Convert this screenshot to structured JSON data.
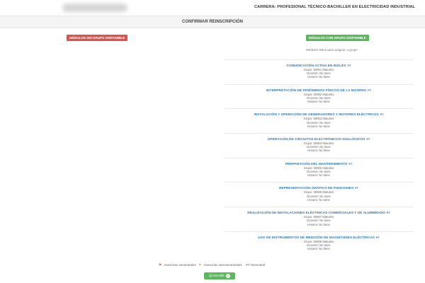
{
  "header": {
    "career": "CARRERA: PROFESIONAL TÉCNICO-BACHILLER EN ELECTRICIDAD INDUSTRIAL",
    "subtitle": "CONFIRMAR REINSCRIPCIÓN"
  },
  "left": {
    "badge": "MÓDULOS SIN GRUPO DISPONIBLE"
  },
  "right": {
    "badge": "MÓDULOS CON GRUPO DISPONIBLE",
    "hint": "Módulos listos para asignar a grupo",
    "modules": [
      {
        "name": "COMUNICACIÓN ACTIVA EN INGLÉS",
        "sup": "PT",
        "group": "Grupo: 50901 Matutino",
        "docente": "Docente: No tiene",
        "horario": "Horario: No tiene"
      },
      {
        "name": "INTERPRETACIÓN DE FENÓMENOS FÍSICOS DE LA MATERIA",
        "sup": "PT",
        "group": "Grupo: 50902 Matutino",
        "docente": "Docente: No tiene",
        "horario": "Horario: No tiene"
      },
      {
        "name": "INSTALACIÓN Y OPERACIÓN DE GENERADORES Y MOTORES ELÉCTRICOS",
        "sup": "PT",
        "group": "Grupo: 50903 Matutino",
        "docente": "Docente: No tiene",
        "horario": "Horario: No tiene"
      },
      {
        "name": "OPERACIÓN DE CIRCUITOS ELECTRÓNICOS ANALÓGICOS",
        "sup": "PT",
        "group": "Grupo: 50904 Matutino",
        "docente": "Docente: No tiene",
        "horario": "Horario: No tiene"
      },
      {
        "name": "PREPARACIÓN DEL MANTENIMIENTO",
        "sup": "PT",
        "group": "Grupo: 50905 Matutino",
        "docente": "Docente: No tiene",
        "horario": "Horario: No tiene"
      },
      {
        "name": "REPRESENTACIÓN GRÁFICA DE FUNCIONES",
        "sup": "PT",
        "group": "Grupo: 50906 Matutino",
        "docente": "Docente: No tiene",
        "horario": "Horario: No tiene"
      },
      {
        "name": "REALIZACIÓN DE INSTALACIONES ELÉCTRICAS COMERCIALES Y DE ALUMBRADO",
        "sup": "PT",
        "group": "Grupo: 50907 Matutino",
        "docente": "Docente: No tiene",
        "horario": "Horario: No tiene"
      },
      {
        "name": "USO DE INSTRUMENTOS DE MEDICIÓN DE MAGNITUDES ELÉCTRICAS",
        "sup": "PT",
        "group": "Grupo: 50908 Matutino",
        "docente": "Docente: No tiene",
        "horario": "Horario: No tiene"
      }
    ]
  },
  "legend": {
    "items": [
      "Asesorías semestrales",
      "Asesorías intersemestrales",
      "PT Semestral"
    ],
    "flag_colors": [
      "#d9534f",
      "#f0ad4e"
    ]
  },
  "footer": {
    "button_label": "Inscribir",
    "button_count": "8"
  },
  "colors": {
    "accent_green": "#5cb85c",
    "accent_red": "#d9534f",
    "link_blue": "#337ab7"
  }
}
